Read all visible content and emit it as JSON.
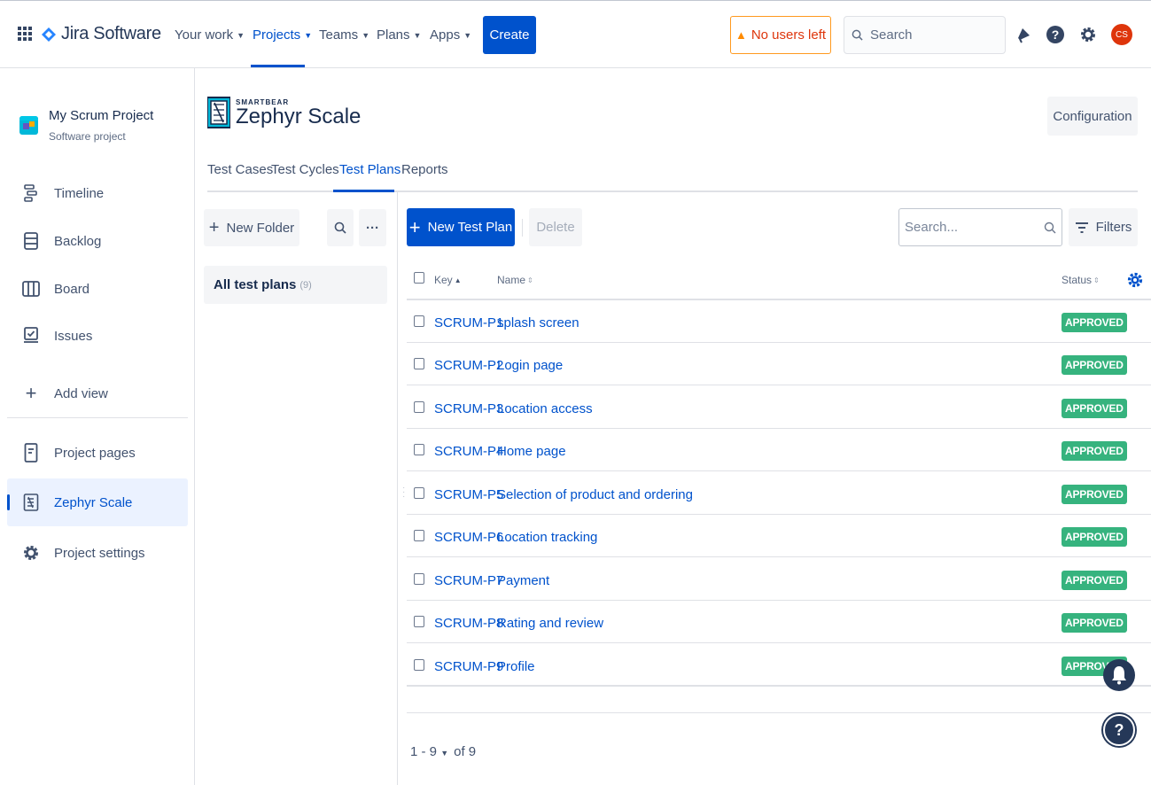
{
  "topnav": {
    "product": "Jira Software",
    "items": [
      {
        "label": "Your work"
      },
      {
        "label": "Projects"
      },
      {
        "label": "Teams"
      },
      {
        "label": "Plans"
      },
      {
        "label": "Apps"
      }
    ],
    "create_label": "Create",
    "warning_label": "No users left",
    "search_placeholder": "Search",
    "avatar_initials": "CS",
    "icons": [
      "app-switcher-icon",
      "notifications-icon",
      "help-icon",
      "settings-icon"
    ]
  },
  "sidebar": {
    "project_name": "My Scrum Project",
    "project_type": "Software project",
    "items": [
      {
        "label": "Timeline",
        "icon": "timeline-icon"
      },
      {
        "label": "Backlog",
        "icon": "backlog-icon"
      },
      {
        "label": "Board",
        "icon": "board-icon"
      },
      {
        "label": "Issues",
        "icon": "issues-icon"
      },
      {
        "label": "Add view",
        "icon": "plus-icon"
      },
      {
        "label": "Project pages",
        "icon": "pages-icon"
      },
      {
        "label": "Zephyr Scale",
        "icon": "zephyr-icon"
      },
      {
        "label": "Project settings",
        "icon": "gear-icon"
      }
    ]
  },
  "app": {
    "brand_small": "SMARTBEAR",
    "brand_name": "Zephyr Scale",
    "configuration_label": "Configuration",
    "tabs": [
      {
        "label": "Test Cases"
      },
      {
        "label": "Test Cycles"
      },
      {
        "label": "Test Plans"
      },
      {
        "label": "Reports"
      }
    ]
  },
  "folders": {
    "new_folder_label": "New Folder",
    "more_label": "···",
    "all_label": "All test plans",
    "all_count": "(9)"
  },
  "toolbar": {
    "new_plan_label": "New Test Plan",
    "delete_label": "Delete",
    "search_placeholder": "Search...",
    "filters_label": "Filters"
  },
  "table": {
    "columns": {
      "key": "Key",
      "name": "Name",
      "status": "Status"
    },
    "rows": [
      {
        "key": "SCRUM-P1",
        "name": "splash screen",
        "status": "APPROVED"
      },
      {
        "key": "SCRUM-P2",
        "name": "Login page",
        "status": "APPROVED"
      },
      {
        "key": "SCRUM-P3",
        "name": "Location access",
        "status": "APPROVED"
      },
      {
        "key": "SCRUM-P4",
        "name": "Home page",
        "status": "APPROVED"
      },
      {
        "key": "SCRUM-P5",
        "name": "Selection of product and ordering",
        "status": "APPROVED"
      },
      {
        "key": "SCRUM-P6",
        "name": "Location tracking",
        "status": "APPROVED"
      },
      {
        "key": "SCRUM-P7",
        "name": "Payment",
        "status": "APPROVED"
      },
      {
        "key": "SCRUM-P8",
        "name": "Rating and review",
        "status": "APPROVED"
      },
      {
        "key": "SCRUM-P9",
        "name": "Profile",
        "status": "APPROVED"
      }
    ]
  },
  "pagination": {
    "range": "1 - 9",
    "total": "of 9"
  },
  "colors": {
    "primary": "#0052cc",
    "approved": "#36b37e",
    "warning": "#ff991f"
  }
}
